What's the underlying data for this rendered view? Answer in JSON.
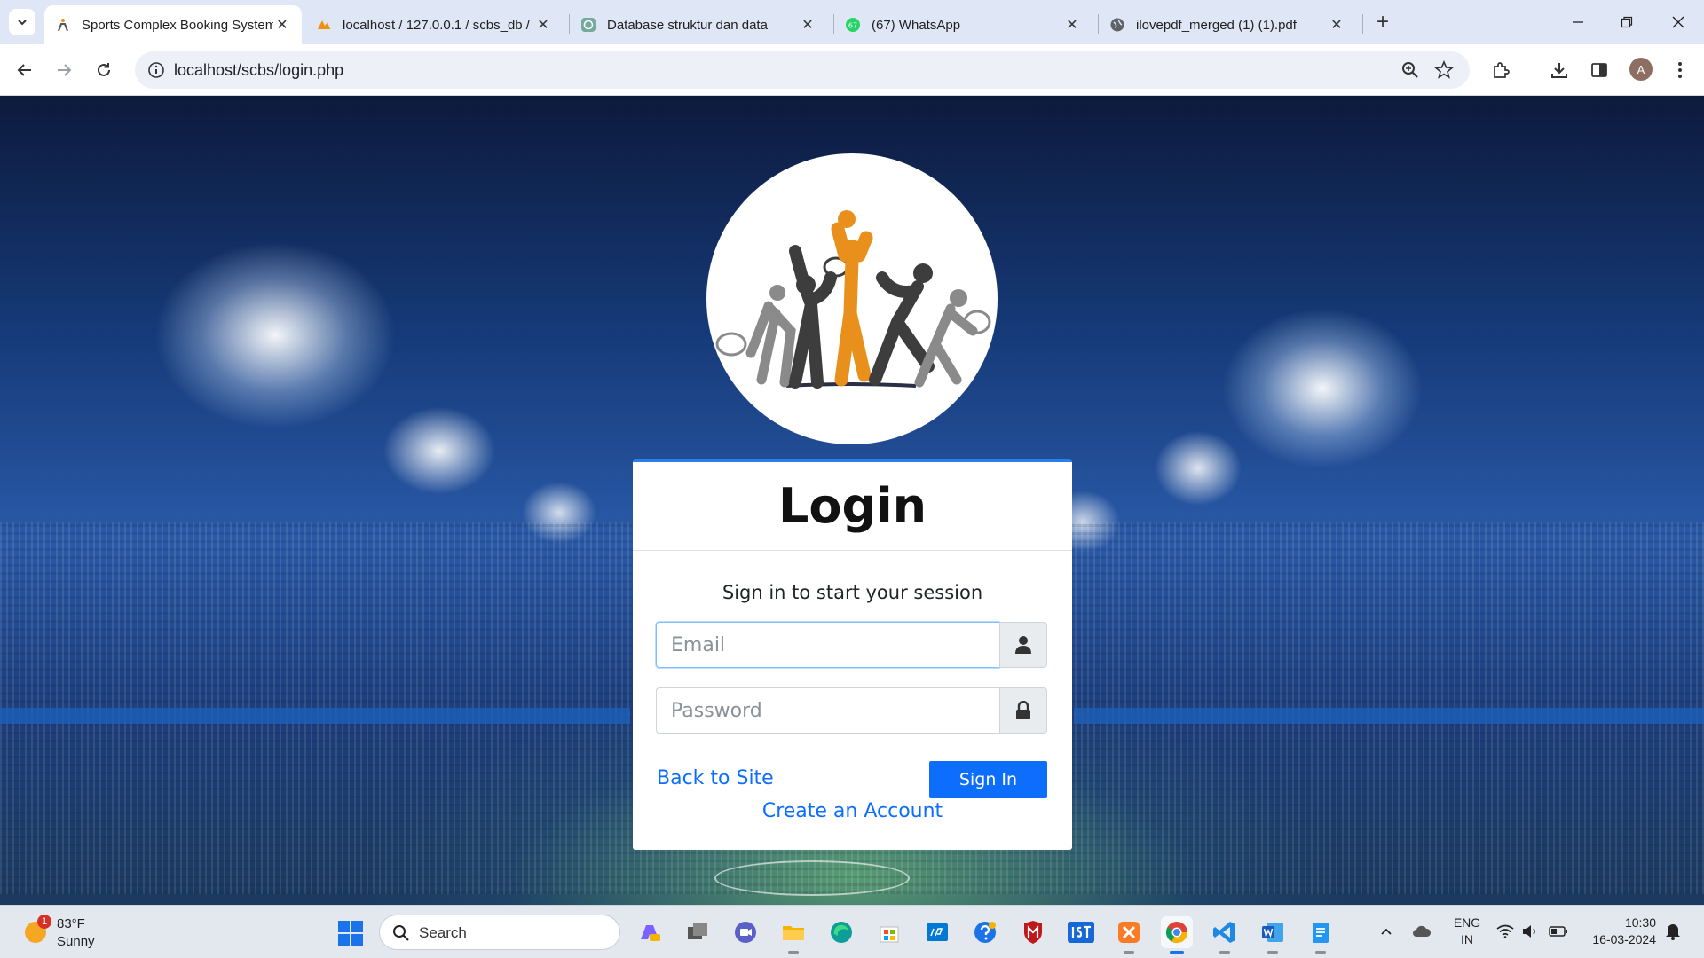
{
  "browser": {
    "tabs": [
      {
        "title": "Sports Complex Booking System",
        "active": true
      },
      {
        "title": "localhost / 127.0.0.1 / scbs_db / ",
        "active": false
      },
      {
        "title": "Database struktur dan data",
        "active": false
      },
      {
        "title": "(67) WhatsApp",
        "active": false
      },
      {
        "title": "ilovepdf_merged (1) (1).pdf",
        "active": false
      }
    ],
    "whatsapp_badge": "67",
    "url": "localhost/scbs/login.php",
    "profile_initial": "A"
  },
  "login": {
    "title": "Login",
    "message": "Sign in to start your session",
    "email_placeholder": "Email",
    "password_placeholder": "Password",
    "back_link": "Back to Site",
    "signin_label": "Sign In",
    "create_account_link": "Create an Account"
  },
  "taskbar": {
    "weather_temp": "83°F",
    "weather_condition": "Sunny",
    "weather_badge": "1",
    "search_placeholder": "Search",
    "language_line1": "ENG",
    "language_line2": "IN",
    "time": "10:30",
    "date": "16-03-2024"
  },
  "colors": {
    "primary": "#0d6efd",
    "tab_bar": "#dfe6f5",
    "taskbar": "#e3e8ef",
    "logo_orange": "#e8901b"
  }
}
